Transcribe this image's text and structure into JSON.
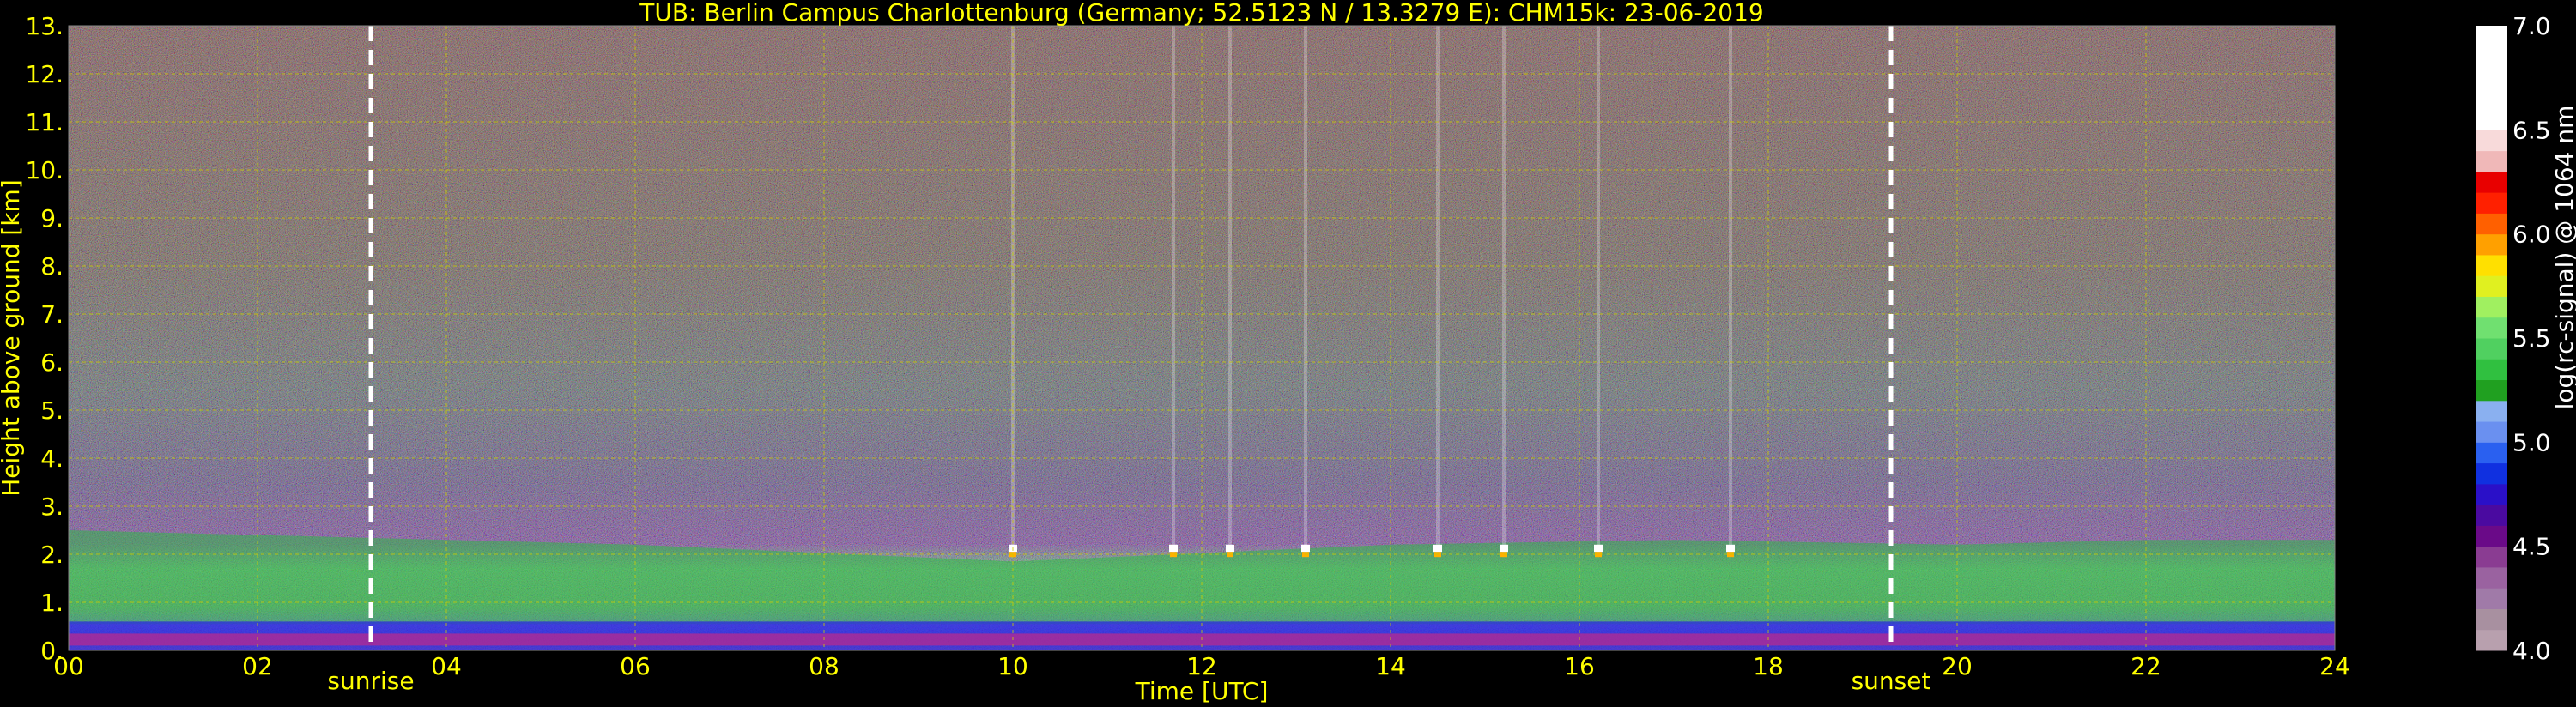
{
  "chart_data": {
    "type": "heatmap",
    "title": "TUB: Berlin Campus Charlottenburg (Germany; 52.5123 N / 13.3279 E):    CHM15k: 23-06-2019",
    "xlabel": "Time [UTC]",
    "ylabel": "Height above ground [km]",
    "xlim": [
      0,
      24
    ],
    "ylim": [
      0,
      13
    ],
    "x_ticks": [
      "00",
      "02",
      "04",
      "06",
      "08",
      "10",
      "12",
      "14",
      "16",
      "18",
      "20",
      "22",
      "24"
    ],
    "y_ticks": [
      "0.",
      "1.",
      "2.",
      "3.",
      "4.",
      "5.",
      "6.",
      "7.",
      "8.",
      "9.",
      "10.",
      "11.",
      "12.",
      "13."
    ],
    "grid": true,
    "annotations": [
      {
        "label": "sunrise",
        "time": 3.2
      },
      {
        "label": "sunset",
        "time": 19.3
      }
    ],
    "colorbar": {
      "label": "log(rc-signal) @ 1064 nm",
      "range": [
        4.0,
        7.0
      ],
      "ticks": [
        "4.0",
        "4.5",
        "5.0",
        "5.5",
        "6.0",
        "6.5",
        "7.0"
      ]
    },
    "layers": [
      {
        "name": "surface layer",
        "top_km": 0.6,
        "level": 4.8
      },
      {
        "name": "boundary layer",
        "top_km_morning": 2.5,
        "top_km_noon": 2.2,
        "top_km_evening": 2.3,
        "level": 5.3
      },
      {
        "name": "cloud tops",
        "times": [
          10.0,
          11.7,
          12.3,
          13.1,
          14.5,
          15.2,
          16.2,
          17.6
        ],
        "height_km": 2.05,
        "level": 6.5
      }
    ],
    "colors": {
      "background": "#000000",
      "axis_text": "#ffff00",
      "grid": "#cccc00",
      "colorbar_text": "#ffffff"
    }
  }
}
